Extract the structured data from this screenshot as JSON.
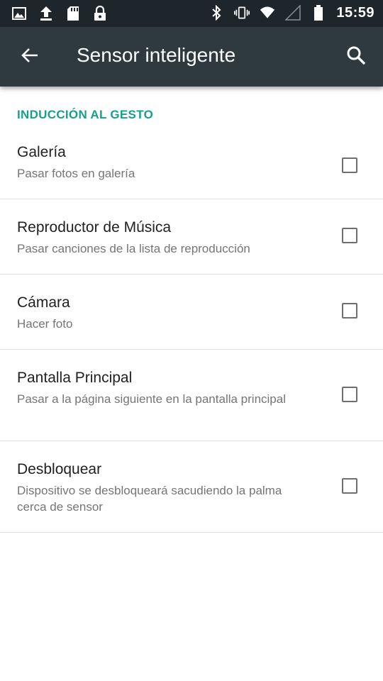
{
  "statusbar": {
    "left_icons": [
      "image-icon",
      "upload-icon",
      "sd-card-icon",
      "lock-icon"
    ],
    "right_icons": [
      "bluetooth-icon",
      "vibrate-icon",
      "wifi-icon",
      "signal-icon",
      "battery-icon"
    ],
    "time": "15:59"
  },
  "toolbar": {
    "title": "Sensor inteligente"
  },
  "section": {
    "header": "INDUCCIÓN AL GESTO"
  },
  "items": [
    {
      "title": "Galería",
      "subtitle": "Pasar fotos en galería",
      "checked": false
    },
    {
      "title": "Reproductor de Música",
      "subtitle": "Pasar canciones de la lista de reproducción",
      "checked": false
    },
    {
      "title": "Cámara",
      "subtitle": "Hacer foto",
      "checked": false
    },
    {
      "title": "Pantalla Principal",
      "subtitle": "Pasar a la página siguiente en la pantalla principal",
      "checked": false
    },
    {
      "title": "Desbloquear",
      "subtitle": "Dispositivo se desbloqueará sacudiendo la palma cerca de sensor",
      "checked": false
    }
  ],
  "colors": {
    "statusbar_bg": "#1f262b",
    "toolbar_bg": "#2e3a40",
    "accent": "#1a9e8c"
  }
}
